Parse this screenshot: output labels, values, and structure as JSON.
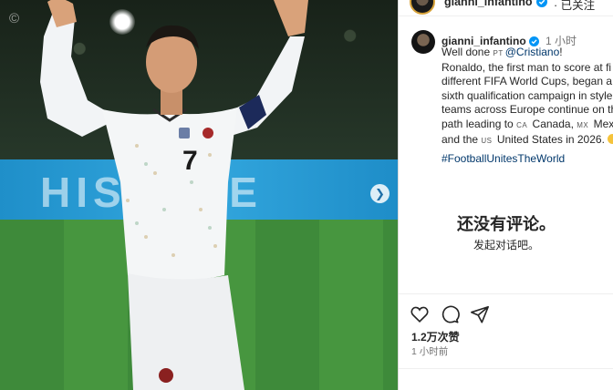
{
  "photo": {
    "watermark": "©",
    "board_text": "HISENSE",
    "shirt_number": "7",
    "next_icon": "chevron-right-icon"
  },
  "header": {
    "username": "gianni_infantino",
    "follow_status": "· 已关注"
  },
  "caption": {
    "username": "gianni_infantino",
    "time": "1 小时",
    "lines": {
      "l1_prefix": "Well done ",
      "l1_flag": "PT",
      "l1_mention": "@Cristiano",
      "l1_suffix": "!",
      "l2": "Ronaldo, the first man to score at fi",
      "l3": "different FIFA World Cups, began a",
      "l4": "sixth qualification campaign in style",
      "l5": "teams across Europe continue on th",
      "l6_prefix": "path leading to ",
      "l6_flag1": "CA",
      "l6_mid": " Canada, ",
      "l6_flag2": "MX",
      "l6_suffix": " Mex",
      "l7_prefix": "and the ",
      "l7_flag": "US",
      "l7_suffix": " United States in 2026. "
    },
    "hashtag": "#FootballUnitesTheWorld"
  },
  "comments": {
    "empty_title": "还没有评论。",
    "empty_subtitle": "发起对话吧。"
  },
  "actions": {
    "like_icon": "heart-icon",
    "comment_icon": "comment-icon",
    "share_icon": "share-icon",
    "likes": "1.2万次赞",
    "posted": "1 小时前"
  },
  "colors": {
    "link": "#00376b",
    "verified": "#0095f6",
    "muted": "#737373"
  }
}
